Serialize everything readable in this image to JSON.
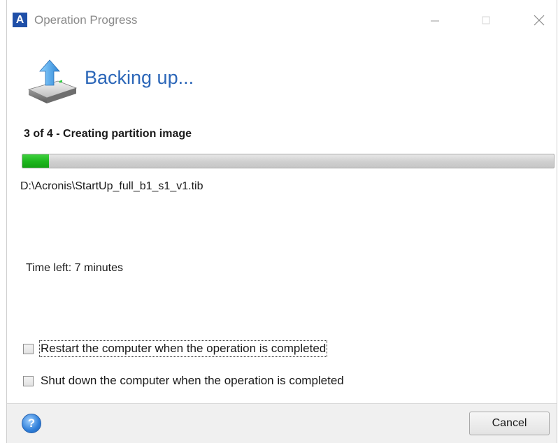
{
  "window": {
    "title": "Operation Progress",
    "logo_letter": "A"
  },
  "header": {
    "title": "Backing up..."
  },
  "progress": {
    "step_label": "3 of 4 - Creating partition image",
    "percent": 5,
    "file_path": "D:\\Acronis\\StartUp_full_b1_s1_v1.tib",
    "time_left": "Time left: 7 minutes"
  },
  "options": [
    {
      "label": "Restart the computer when the operation is completed",
      "checked": false
    },
    {
      "label": "Shut down the computer when the operation is completed",
      "checked": false
    }
  ],
  "footer": {
    "help_icon": "?",
    "cancel_label": "Cancel"
  },
  "colors": {
    "accent_title": "#2b66b8",
    "progress_fill": "#1db51d"
  }
}
